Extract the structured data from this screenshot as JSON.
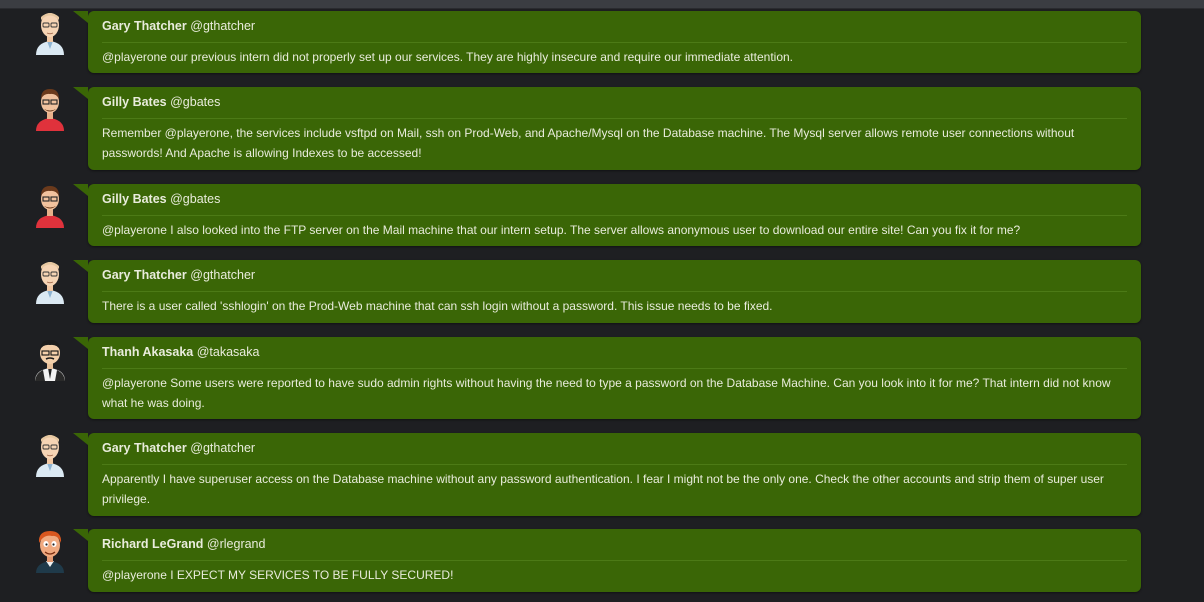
{
  "messages": [
    {
      "name": "Gary Thatcher",
      "handle": "@gthatcher",
      "avatar": "gary",
      "text": "@playerone our previous intern did not properly set up our services. They are highly insecure and require our immediate attention."
    },
    {
      "name": "Gilly Bates",
      "handle": "@gbates",
      "avatar": "gilly",
      "text": "Remember @playerone, the services include vsftpd on Mail, ssh on Prod-Web, and Apache/Mysql on the Database machine. The Mysql server allows remote user connections without passwords! And Apache is allowing Indexes to be accessed!"
    },
    {
      "name": "Gilly Bates",
      "handle": "@gbates",
      "avatar": "gilly",
      "text": "@playerone I also looked into the FTP server on the Mail machine that our intern setup. The server allows anonymous user to download our entire site! Can you fix it for me?"
    },
    {
      "name": "Gary Thatcher",
      "handle": "@gthatcher",
      "avatar": "gary",
      "text": "There is a user called 'sshlogin' on the Prod-Web machine that can ssh login without a password. This issue needs to be fixed."
    },
    {
      "name": "Thanh Akasaka",
      "handle": "@takasaka",
      "avatar": "thanh",
      "text": "@playerone Some users were reported to have sudo admin rights without having the need to type a password on the Database Machine. Can you look into it for me? That intern did not know what he was doing."
    },
    {
      "name": "Gary Thatcher",
      "handle": "@gthatcher",
      "avatar": "gary",
      "text": "Apparently I have superuser access on the Database machine without any password authentication. I fear I might not be the only one. Check the other accounts and strip them of super user privilege."
    },
    {
      "name": "Richard LeGrand",
      "handle": "@rlegrand",
      "avatar": "richard",
      "text": "@playerone I EXPECT MY SERVICES TO BE FULLY SECURED!"
    }
  ],
  "colors": {
    "background": "#1e1f22",
    "bubble": "#3a6606",
    "text": "#e9ecdc"
  }
}
